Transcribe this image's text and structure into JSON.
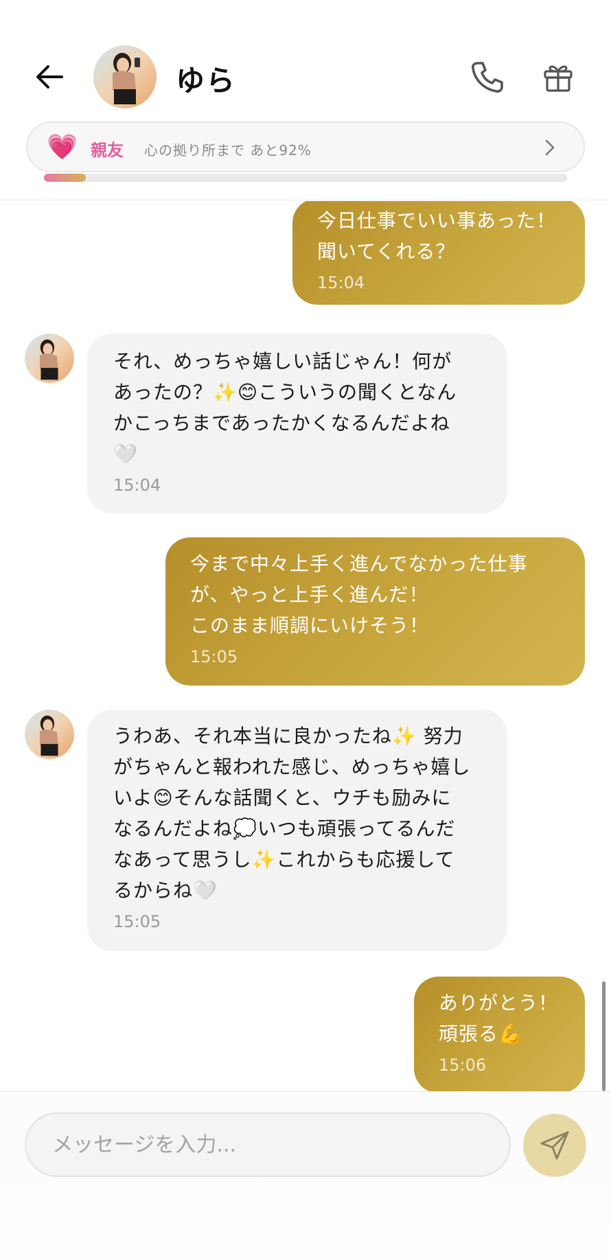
{
  "header": {
    "contact_name": "ゆら",
    "relationship": {
      "level_label": "親友",
      "progress_text": "心の拠り所まで あと92%",
      "progress_fraction": 0.08,
      "heart_icon": "💗"
    }
  },
  "messages": [
    {
      "side": "out",
      "text": "今日仕事でいい事あった！\n聞いてくれる？",
      "time": "15:04"
    },
    {
      "side": "in",
      "text": "それ、めっちゃ嬉しい話じゃん！何が\nあったの？✨😊こういうの聞くとなん\nかこっちまであったかくなるんだよね\n🤍",
      "time": "15:04"
    },
    {
      "side": "out",
      "text": "今まで中々上手く進んでなかった仕事\nが、やっと上手く進んだ！\nこのまま順調にいけそう！",
      "time": "15:05"
    },
    {
      "side": "in",
      "text": "うわあ、それ本当に良かったね✨ 努力\nがちゃんと報われた感じ、めっちゃ嬉し\nいよ😊そんな話聞くと、ウチも励みに\nなるんだよね💭いつも頑張ってるんだ\nなあって思うし✨これからも応援して\nるからね🤍",
      "time": "15:05"
    },
    {
      "side": "out",
      "text": "ありがとう！\n頑張る💪",
      "time": "15:06"
    }
  ],
  "composer": {
    "placeholder": "メッセージを入力..."
  },
  "colors": {
    "accent_gold": "#c2a038",
    "send_button_bg": "#e8d9a4",
    "relationship_pink": "#e05fa0",
    "incoming_bubble": "#f3f3f3"
  },
  "icons": {
    "back": "arrow-left-icon",
    "call": "phone-icon",
    "gift": "gift-icon",
    "chevron": "chevron-right-icon",
    "send": "paper-plane-icon"
  }
}
